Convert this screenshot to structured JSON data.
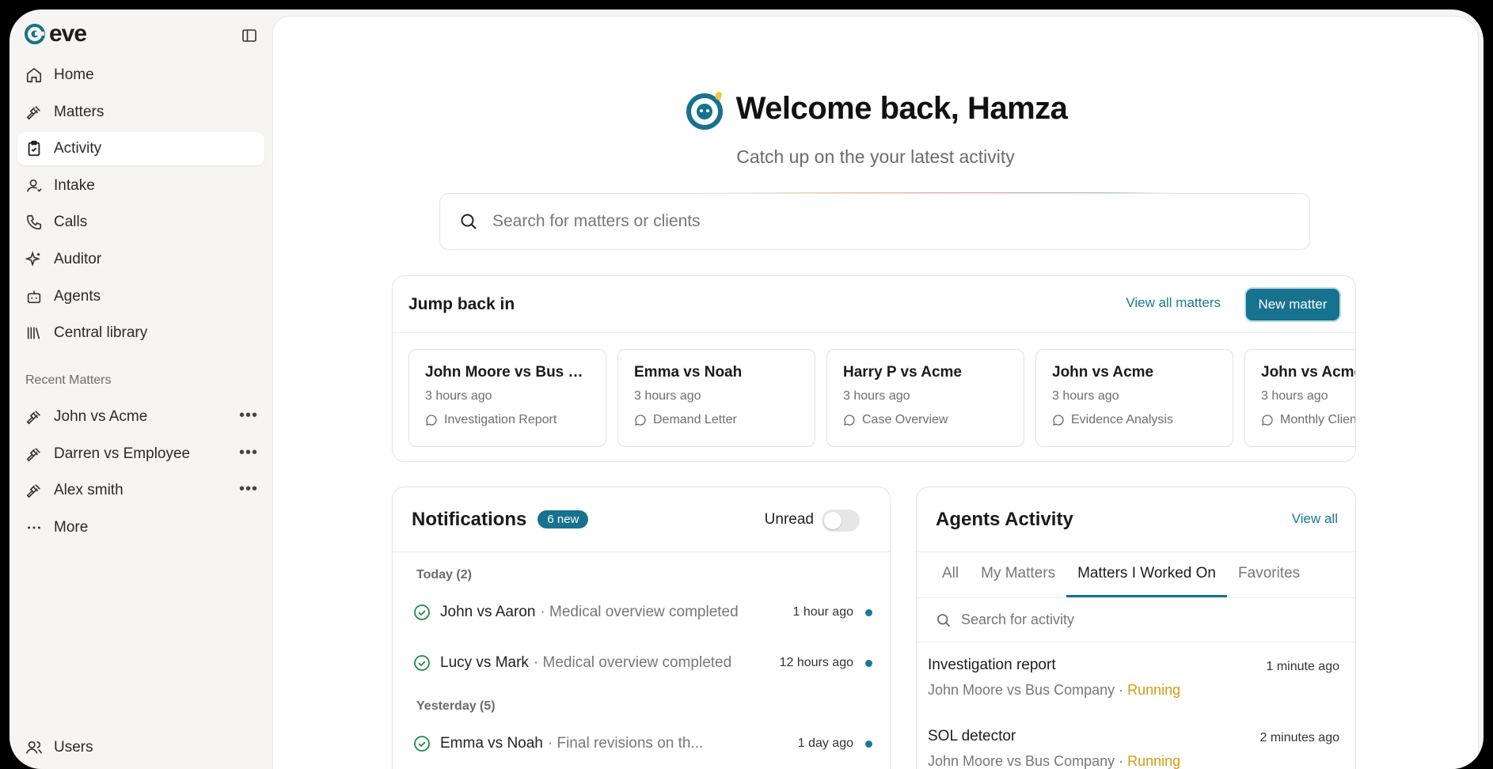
{
  "app": {
    "name": "eve"
  },
  "sidebar": {
    "nav": [
      {
        "label": "Home",
        "icon": "home-icon"
      },
      {
        "label": "Matters",
        "icon": "gavel-icon"
      },
      {
        "label": "Activity",
        "icon": "clipboard-check-icon",
        "active": true
      },
      {
        "label": "Intake",
        "icon": "user-icon"
      },
      {
        "label": "Calls",
        "icon": "phone-icon"
      },
      {
        "label": "Auditor",
        "icon": "sparkle-icon"
      },
      {
        "label": "Agents",
        "icon": "bot-icon"
      },
      {
        "label": "Central library",
        "icon": "library-icon"
      }
    ],
    "recent_label": "Recent Matters",
    "recent": [
      {
        "label": "John vs Acme"
      },
      {
        "label": "Darren vs Employee"
      },
      {
        "label": "Alex smith"
      }
    ],
    "more_label": "More",
    "users_label": "Users"
  },
  "main": {
    "welcome": "Welcome back, Hamza",
    "subtitle": "Catch up on the your latest activity",
    "search_placeholder": "Search for matters or clients",
    "jump": {
      "title": "Jump back in",
      "view_all": "View all matters",
      "new_matter": "New matter",
      "cards": [
        {
          "title": "John Moore vs Bus C...",
          "time": "3 hours ago",
          "doc": "Investigation Report"
        },
        {
          "title": "Emma vs Noah",
          "time": "3 hours ago",
          "doc": "Demand Letter"
        },
        {
          "title": "Harry P vs Acme",
          "time": "3 hours ago",
          "doc": "Case Overview"
        },
        {
          "title": "John vs Acme",
          "time": "3 hours ago",
          "doc": "Evidence Analysis"
        },
        {
          "title": "John vs Acme",
          "time": "3 hours ago",
          "doc": "Monthly Client"
        }
      ]
    },
    "notifications": {
      "title": "Notifications",
      "badge": "6 new",
      "unread_label": "Unread",
      "groups": [
        {
          "label": "Today (2)",
          "items": [
            {
              "matter": "John vs Aaron",
              "desc": "· Medical overview completed",
              "time": "1 hour ago"
            },
            {
              "matter": "Lucy vs Mark",
              "desc": "· Medical overview completed",
              "time": "12 hours ago"
            }
          ]
        },
        {
          "label": "Yesterday (5)",
          "items": [
            {
              "matter": "Emma vs Noah",
              "desc": "· Final revisions on th...",
              "time": "1 day ago"
            }
          ]
        }
      ]
    },
    "agents": {
      "title": "Agents Activity",
      "view_all": "View all",
      "tabs": [
        "All",
        "My Matters",
        "Matters I Worked On",
        "Favorites"
      ],
      "active_tab": 2,
      "search_placeholder": "Search for activity",
      "items": [
        {
          "title": "Investigation report",
          "matter": "John Moore vs Bus Company ·",
          "status": "Running",
          "time": "1 minute ago"
        },
        {
          "title": "SOL detector",
          "matter": "John Moore vs Bus Company ·",
          "status": "Running",
          "time": "2 minutes ago"
        }
      ]
    }
  },
  "colors": {
    "accent": "#16728f",
    "running": "#d89a10",
    "success": "#1f8a4c"
  }
}
